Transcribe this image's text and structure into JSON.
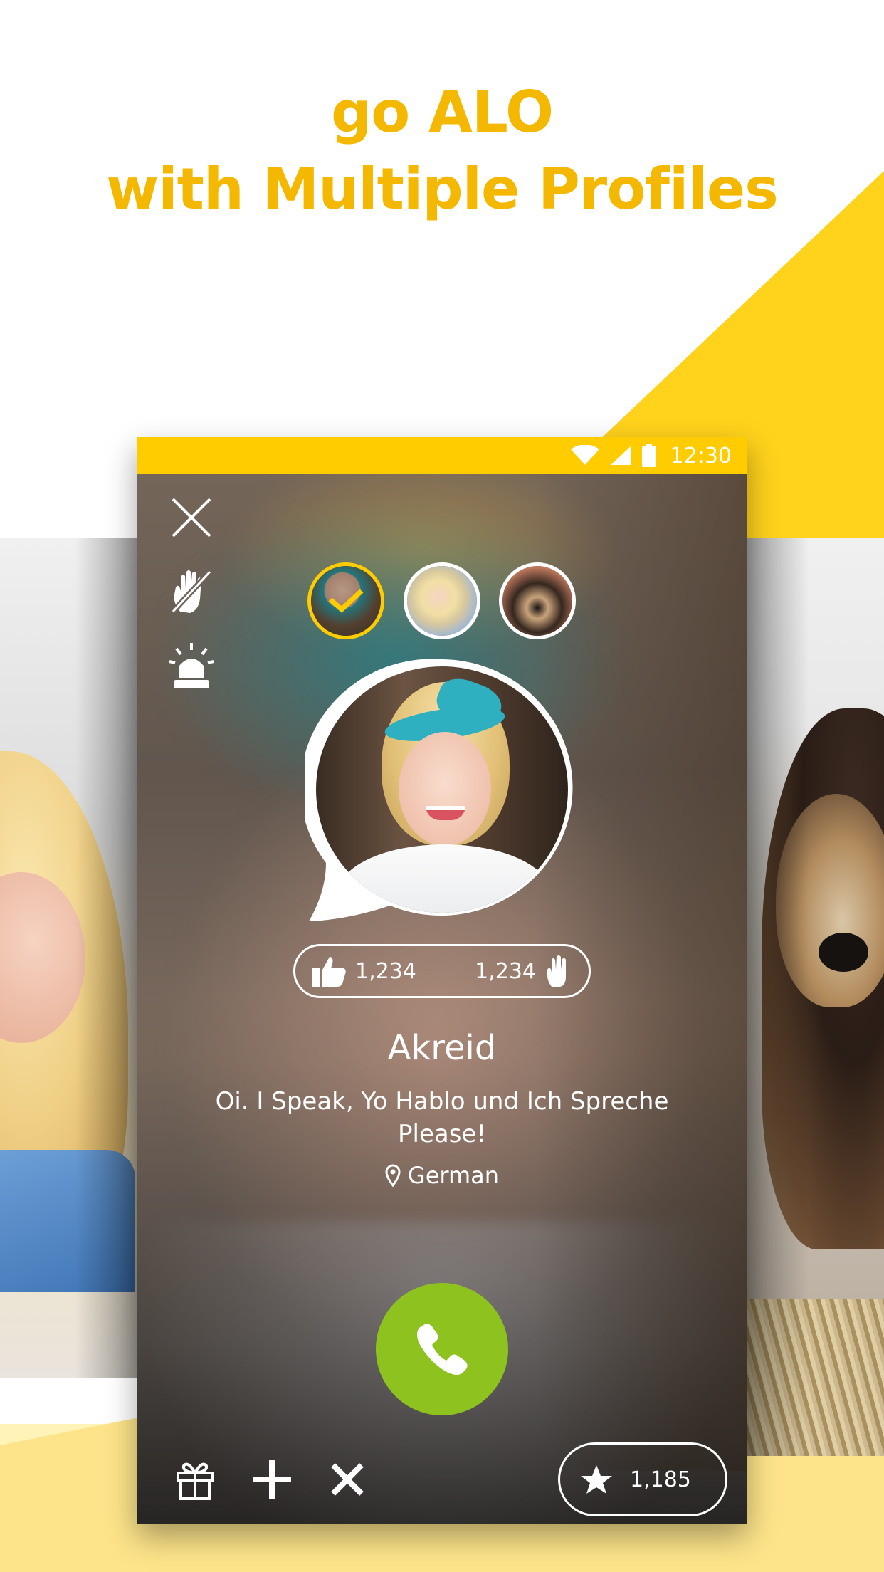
{
  "headline": {
    "line1": "go ALO",
    "line2": "with Multiple Profiles"
  },
  "colors": {
    "brand_yellow": "#ffcc00",
    "headline": "#f5b800",
    "call_green": "#8ec21f"
  },
  "status_bar": {
    "time": "12:30",
    "icons": [
      "wifi-icon",
      "cellular-signal-icon",
      "battery-icon"
    ]
  },
  "sidebar_icons": [
    "close-icon",
    "hand-off-icon",
    "alarm-siren-icon"
  ],
  "profiles": [
    {
      "name": "profile-woman-headband",
      "selected": true
    },
    {
      "name": "profile-blonde-woman",
      "selected": false
    },
    {
      "name": "profile-dog",
      "selected": false
    }
  ],
  "stats": {
    "likes": "1,234",
    "waves": "1,234"
  },
  "profile": {
    "name": "Akreid",
    "bio": "Oi. I Speak, Yo Hablo und Ich Spreche Please!",
    "location": "German"
  },
  "bottom_bar": {
    "icons": [
      "gift-icon",
      "plus-icon",
      "x-icon"
    ],
    "points": "1,185"
  }
}
